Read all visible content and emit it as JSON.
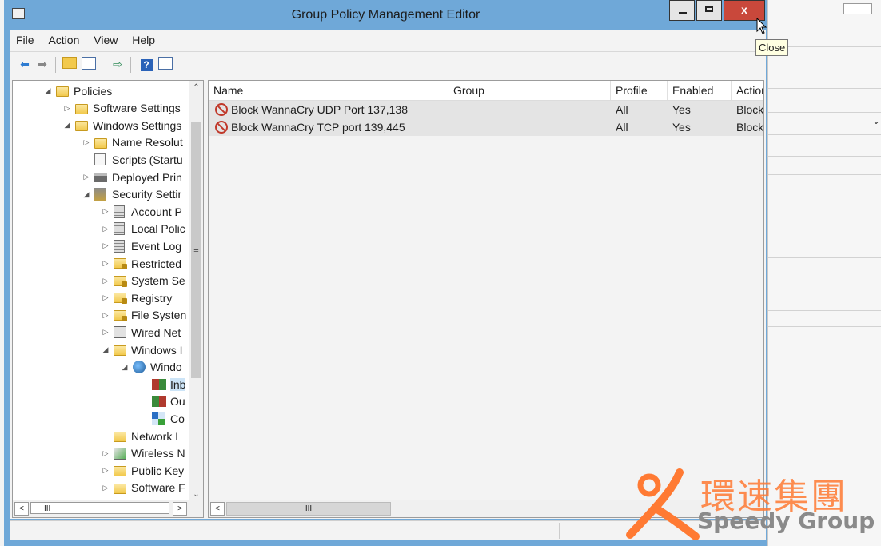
{
  "window": {
    "title": "Group Policy Management Editor",
    "close_glyph": "x",
    "tooltip": "Close"
  },
  "menu": [
    "File",
    "Action",
    "View",
    "Help"
  ],
  "toolbar": {
    "icons": [
      "back-arrow-icon",
      "forward-arrow-icon",
      "up-folder-icon",
      "show-hide-tree-icon",
      "export-list-icon",
      "help-icon",
      "show-action-pane-icon"
    ]
  },
  "tree": {
    "items": [
      {
        "label": "Policies",
        "expander": "◢",
        "icon": "folder-icon"
      },
      {
        "label": "Software Settings",
        "expander": "▷",
        "icon": "folder-icon"
      },
      {
        "label": "Windows Settings",
        "expander": "◢",
        "icon": "folder-icon"
      },
      {
        "label": "Name Resolut",
        "expander": "▷",
        "icon": "folder-icon"
      },
      {
        "label": "Scripts (Startu",
        "expander": "",
        "icon": "scroll-icon"
      },
      {
        "label": "Deployed Prin",
        "expander": "▷",
        "icon": "printer-icon"
      },
      {
        "label": "Security Settir",
        "expander": "◢",
        "icon": "security-shield-icon"
      },
      {
        "label": "Account P",
        "expander": "▷",
        "icon": "policy-doc-icon"
      },
      {
        "label": "Local Polic",
        "expander": "▷",
        "icon": "policy-doc-icon"
      },
      {
        "label": "Event Log",
        "expander": "▷",
        "icon": "policy-doc-icon"
      },
      {
        "label": "Restricted",
        "expander": "▷",
        "icon": "lock-folder-icon"
      },
      {
        "label": "System Se",
        "expander": "▷",
        "icon": "lock-folder-icon"
      },
      {
        "label": "Registry",
        "expander": "▷",
        "icon": "lock-folder-icon"
      },
      {
        "label": "File Systen",
        "expander": "▷",
        "icon": "lock-folder-icon"
      },
      {
        "label": "Wired Net",
        "expander": "▷",
        "icon": "wired-network-icon"
      },
      {
        "label": "Windows I",
        "expander": "◢",
        "icon": "folder-icon"
      },
      {
        "label": "Windo",
        "expander": "◢",
        "icon": "firewall-globe-icon"
      },
      {
        "label": "Inb",
        "expander": "",
        "icon": "inbound-rules-icon",
        "selected": true
      },
      {
        "label": "Ou",
        "expander": "",
        "icon": "outbound-rules-icon"
      },
      {
        "label": "Co",
        "expander": "",
        "icon": "connection-security-icon"
      },
      {
        "label": "Network L",
        "expander": "",
        "icon": "folder-icon"
      },
      {
        "label": "Wireless N",
        "expander": "▷",
        "icon": "wireless-network-icon"
      },
      {
        "label": "Public Key",
        "expander": "▷",
        "icon": "folder-icon"
      },
      {
        "label": "Software F",
        "expander": "▷",
        "icon": "folder-icon"
      }
    ]
  },
  "list": {
    "columns": [
      "Name",
      "Group",
      "Profile",
      "Enabled",
      "Actior"
    ],
    "rows": [
      {
        "name": "Block WannaCry UDP Port 137,138",
        "group": "",
        "profile": "All",
        "enabled": "Yes",
        "action": "Block"
      },
      {
        "name": "Block WannaCry TCP port 139,445",
        "group": "",
        "profile": "All",
        "enabled": "Yes",
        "action": "Block"
      }
    ]
  },
  "scroll": {
    "grip": "III",
    "left_arrow": "<",
    "right_arrow": ">",
    "up_arrow": "^",
    "down_arrow": "v",
    "tree_grip": "≡"
  },
  "watermark": {
    "chinese": "環速集團",
    "english": "Speedy Group",
    "brand_color": "#ff7a33"
  },
  "colors": {
    "titlebar": "#6fa8d8",
    "close_button": "#c9483b",
    "block_icon": "#c0392b"
  }
}
